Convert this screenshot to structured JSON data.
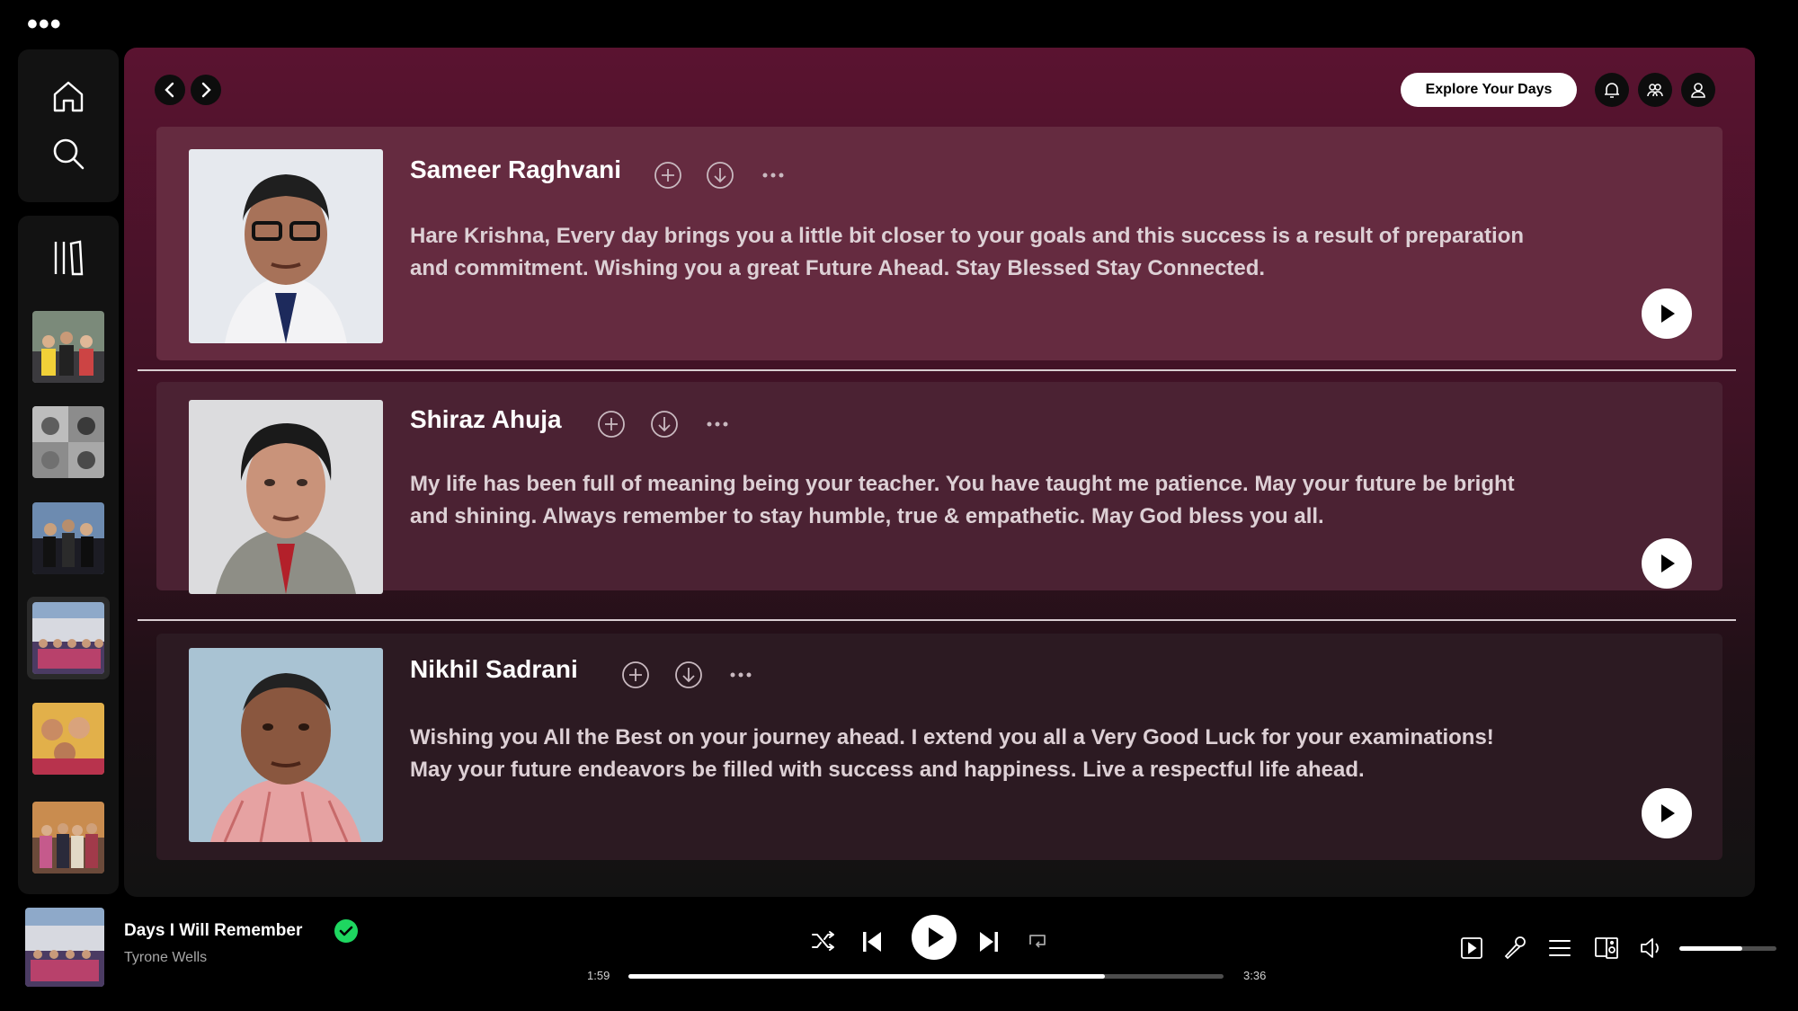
{
  "window": {
    "menu_label": "•••"
  },
  "sidebar": {
    "home_icon": "home-icon",
    "search_icon": "search-icon",
    "library_icon": "library-icon",
    "playlists": [
      {
        "name": "group-photo-1",
        "active": false
      },
      {
        "name": "collage-photo",
        "active": false
      },
      {
        "name": "group-photo-2",
        "active": false
      },
      {
        "name": "group-photo-3",
        "active": true
      },
      {
        "name": "friends-photo",
        "active": false
      },
      {
        "name": "group-photo-4",
        "active": false
      }
    ]
  },
  "header": {
    "explore_label": "Explore Your Days",
    "icons": [
      "bell-icon",
      "friends-icon",
      "profile-icon"
    ]
  },
  "messages": [
    {
      "name": "Sameer Raghvani",
      "text": "Hare Krishna, Every day brings you a little bit closer to your goals and this success is a result of preparation and commitment. Wishing you a great Future Ahead. Stay Blessed Stay Connected."
    },
    {
      "name": "Shiraz Ahuja",
      "text": "My life has been full of meaning being your teacher. You have taught me patience. May your future be bright and shining. Always remember to stay humble, true & empathetic. May God bless you all."
    },
    {
      "name": "Nikhil Sadrani",
      "text": "Wishing you All the Best on your journey ahead. I extend you all a Very Good Luck for your examinations! May your future endeavors be filled with success and happiness. Live a respectful life ahead."
    }
  ],
  "player": {
    "title": "Days I Will Remember",
    "artist": "Tyrone Wells",
    "elapsed": "1:59",
    "duration": "3:36",
    "progress_fraction": 0.8,
    "volume_fraction": 0.65,
    "accent_color": "#1ed760"
  }
}
